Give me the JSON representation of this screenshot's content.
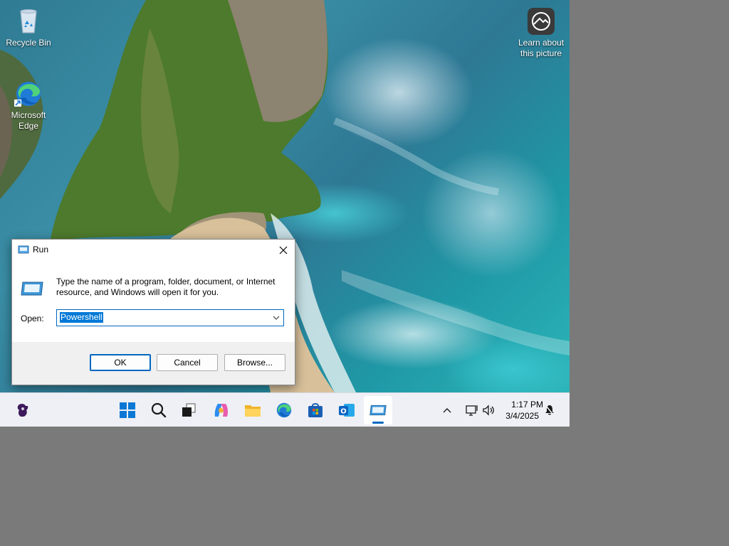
{
  "desktop": {
    "icons": [
      {
        "label": "Recycle Bin"
      },
      {
        "label": "Microsoft Edge"
      },
      {
        "label": "Learn about this picture"
      }
    ]
  },
  "run_dialog": {
    "title": "Run",
    "description": "Type the name of a program, folder, document, or Internet resource, and Windows will open it for you.",
    "open_label": "Open:",
    "open_value": "Powershell",
    "ok_label": "OK",
    "cancel_label": "Cancel",
    "browse_label": "Browse..."
  },
  "taskbar": {
    "apps": [
      "widgets-icon",
      "start-icon",
      "search-icon",
      "task-view-icon",
      "copilot-icon",
      "file-explorer-icon",
      "edge-icon",
      "store-icon",
      "outlook-icon",
      "run-icon"
    ],
    "active_app": "run-icon",
    "tray_icons": [
      "chevron-up-icon",
      "network-icon",
      "volume-icon",
      "notification-icon"
    ],
    "time": "1:17 PM",
    "date": "3/4/2025"
  },
  "colors": {
    "accent": "#0067c0",
    "taskbar": "#eef0f5",
    "selection": "#0078d7"
  }
}
